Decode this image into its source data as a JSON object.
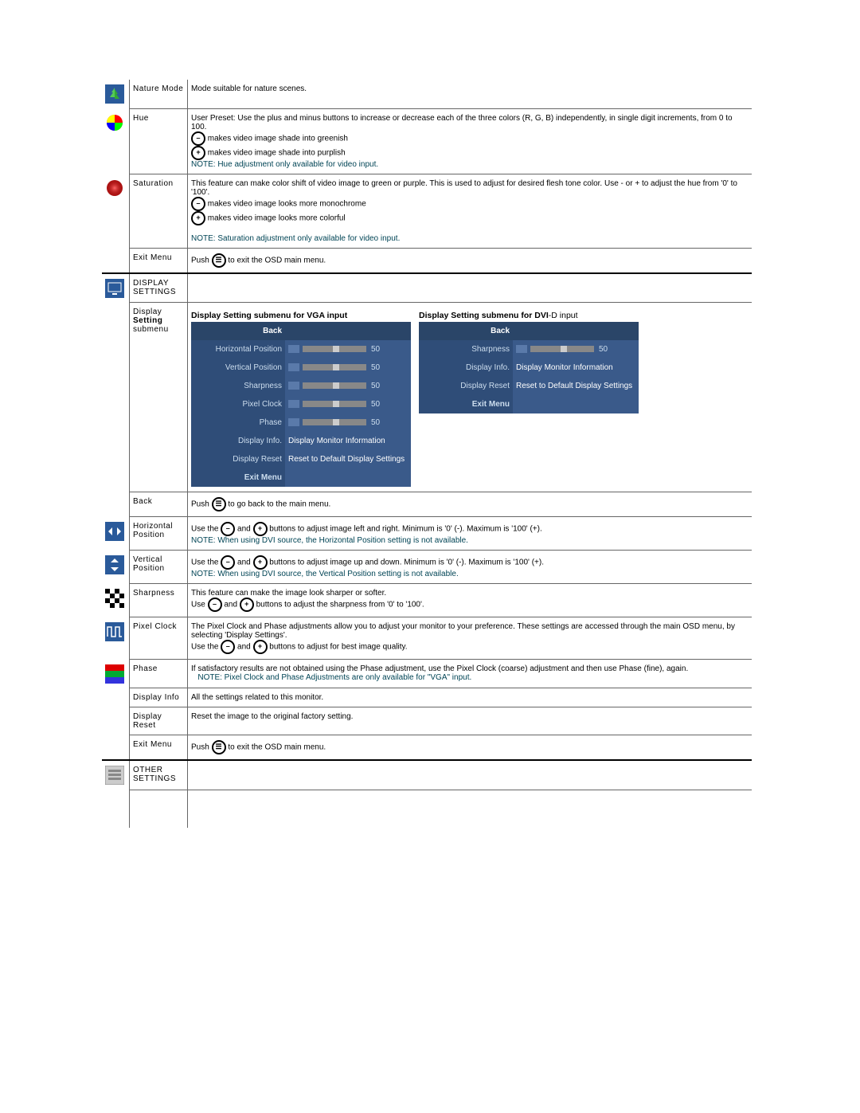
{
  "rows": {
    "nature": {
      "label": "Nature Mode",
      "desc": "Mode suitable for nature scenes."
    },
    "hue": {
      "label": "Hue",
      "line1": "User Preset: Use the plus and minus buttons to increase or decrease each of the three colors (R, G, B) independently, in single digit increments, from 0 to 100.",
      "line2": "makes video image shade into greenish",
      "line3": "makes video image shade into purplish",
      "note": "NOTE: Hue adjustment only available for video input."
    },
    "saturation": {
      "label": "Saturation",
      "line1": "This feature can make color shift of video image to green or purple. This is used to adjust for desired flesh tone color. Use - or + to adjust the hue from '0' to '100'.",
      "line2": "makes video image looks more monochrome",
      "line3": "makes video image looks more colorful",
      "note": "NOTE: Saturation adjustment only available for video input."
    },
    "exit1": {
      "label": "Exit Menu",
      "text_a": "Push ",
      "text_b": " to exit the OSD main menu."
    },
    "display_settings": {
      "label": "DISPLAY SETTINGS"
    },
    "display_submenu": {
      "label1": "Display",
      "label2": "Setting",
      "label3": "submenu",
      "head_vga": "Display Setting  submenu for VGA input",
      "head_dvi_a": "Display Setting  submenu for DVI",
      "head_dvi_b": "-D input",
      "vga": {
        "back": "Back",
        "hp": "Horizontal Position",
        "hp_v": "50",
        "vp": "Vertical Position",
        "vp_v": "50",
        "sh": "Sharpness",
        "sh_v": "50",
        "pc": "Pixel Clock",
        "pc_v": "50",
        "ph": "Phase",
        "ph_v": "50",
        "di": "Display Info.",
        "di_v": "Display Monitor Information",
        "dr": "Display Reset",
        "dr_v": "Reset to Default Display Settings",
        "em": "Exit Menu"
      },
      "dvi": {
        "back": "Back",
        "sh": "Sharpness",
        "sh_v": "50",
        "di": "Display Info.",
        "di_v": "Display Monitor Information",
        "dr": "Display Reset",
        "dr_v": "Reset to Default Display Settings",
        "em": "Exit Menu"
      }
    },
    "back": {
      "label": "Back",
      "text_a": "Push ",
      "text_b": " to go back to the main menu."
    },
    "hpos": {
      "label": "Horizontal Position",
      "text_a": "Use the ",
      "text_b": " and ",
      "text_c": " buttons to adjust image left and right. Minimum is '0' (-). Maximum is '100' (+).",
      "note": "NOTE: When using DVI source, the Horizontal Position setting is not available."
    },
    "vpos": {
      "label": "Vertical Position",
      "text_a": "Use the ",
      "text_b": " and ",
      "text_c": " buttons to adjust image up and down. Minimum is '0' (-). Maximum is '100' (+).",
      "note": "NOTE: When using DVI source, the Vertical Position setting is not available."
    },
    "sharp": {
      "label": "Sharpness",
      "line1": "This feature can make the image look sharper or softer.",
      "line2_a": "Use  ",
      "line2_b": " and ",
      "line2_c": " buttons to adjust the sharpness from '0' to '100'."
    },
    "pixclk": {
      "label": "Pixel Clock",
      "line1": "The Pixel Clock and Phase adjustments allow you to adjust your monitor to your preference. These settings are accessed through the main OSD menu, by selecting 'Display Settings'.",
      "line2_a": "Use the ",
      "line2_b": " and ",
      "line2_c": " buttons to adjust for best image quality."
    },
    "phase": {
      "label": "Phase",
      "line1": "If satisfactory results are not obtained using the Phase adjustment, use the Pixel Clock (coarse) adjustment and then use Phase (fine), again.",
      "note": "NOTE: Pixel Clock and Phase Adjustments are only available for \"VGA\" input."
    },
    "dinfo": {
      "label": "Display Info",
      "desc": "All the settings related to this monitor."
    },
    "dreset": {
      "label": "Display Reset",
      "desc": "Reset the image to the original factory setting."
    },
    "exit2": {
      "label": "Exit Menu",
      "text_a": "Push ",
      "text_b": " to exit the OSD main menu."
    },
    "other": {
      "label": "OTHER SETTINGS"
    }
  },
  "btn": {
    "minus": "–",
    "plus": "+",
    "menu": "☰"
  }
}
